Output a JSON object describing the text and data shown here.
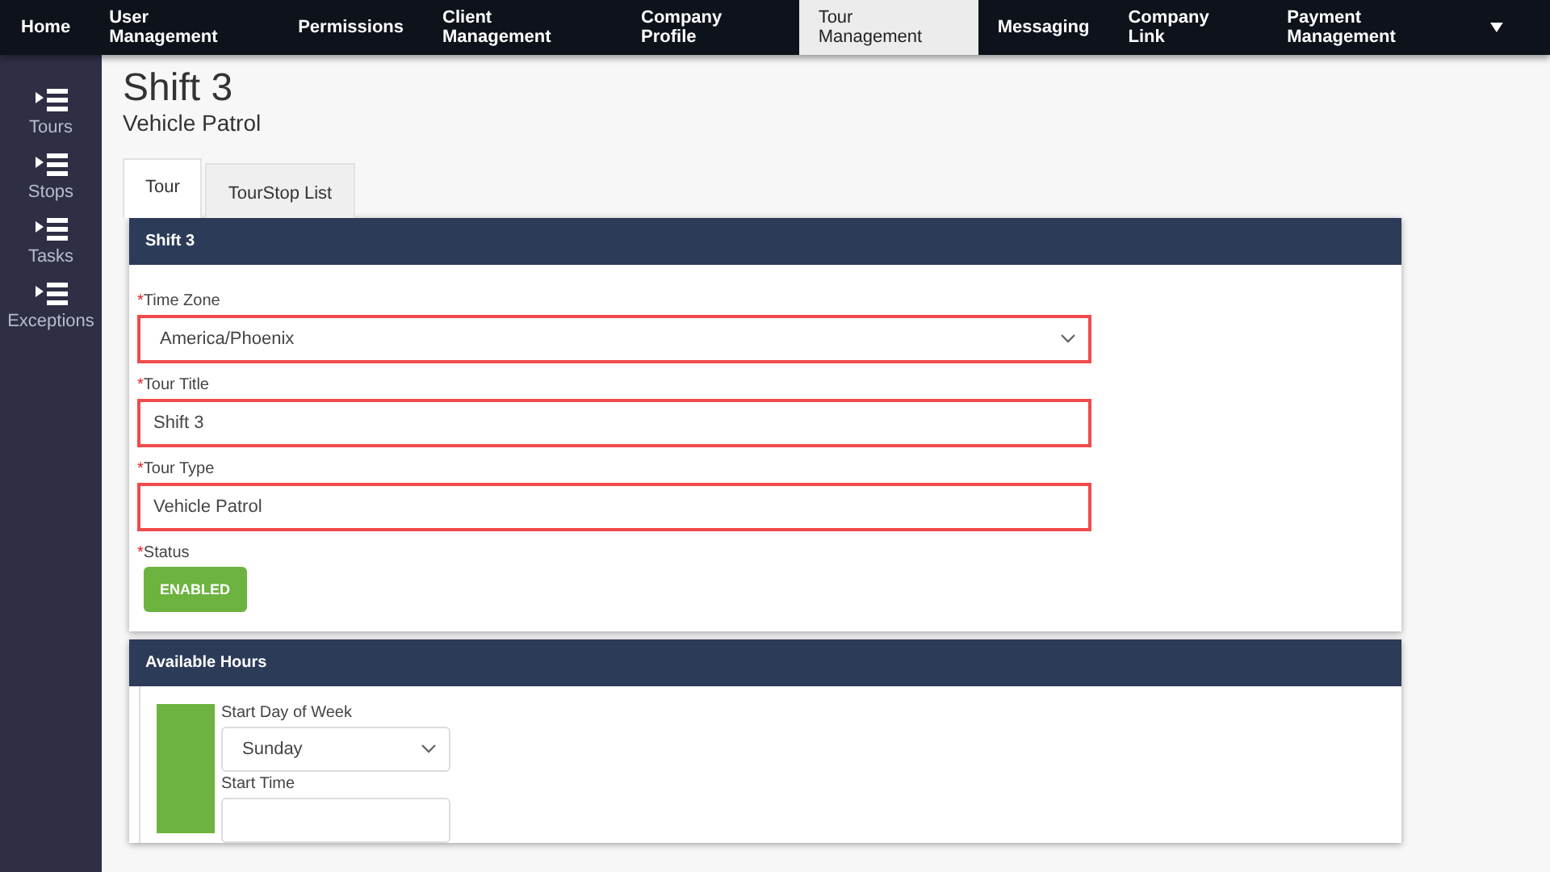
{
  "nav": {
    "items": [
      {
        "label": "Home",
        "selected": false
      },
      {
        "label": "User Management",
        "selected": false
      },
      {
        "label": "Permissions",
        "selected": false
      },
      {
        "label": "Client Management",
        "selected": false
      },
      {
        "label": "Company Profile",
        "selected": false
      },
      {
        "label": "Tour Management",
        "selected": true
      },
      {
        "label": "Messaging",
        "selected": false
      },
      {
        "label": "Company Link",
        "selected": false
      },
      {
        "label": "Payment Management",
        "selected": false
      }
    ]
  },
  "sidebar": {
    "items": [
      {
        "label": "Tours"
      },
      {
        "label": "Stops"
      },
      {
        "label": "Tasks"
      },
      {
        "label": "Exceptions"
      }
    ]
  },
  "page": {
    "title": "Shift 3",
    "subtitle": "Vehicle Patrol"
  },
  "tabs": [
    {
      "label": "Tour",
      "selected": true
    },
    {
      "label": "TourStop List",
      "selected": false
    }
  ],
  "tour_card": {
    "title": "Shift 3",
    "fields": [
      {
        "kind": "select",
        "marker": "*",
        "label": "Time Zone",
        "value": "America/Phoenix",
        "invalid": true
      },
      {
        "kind": "text",
        "marker": "*",
        "label": "Tour Title",
        "value": "Shift 3",
        "invalid": true
      },
      {
        "kind": "text",
        "marker": "*",
        "label": "Tour Type",
        "value": "Vehicle Patrol",
        "invalid": true
      },
      {
        "kind": "toggle",
        "marker": "*",
        "label": "Status",
        "value": "ENABLED",
        "on": true
      }
    ]
  },
  "hours_card": {
    "title": "Available Hours",
    "fields": [
      {
        "kind": "select",
        "label": "Start Day of Week",
        "value": "Sunday"
      },
      {
        "kind": "text",
        "label": "Start Time"
      }
    ]
  }
}
